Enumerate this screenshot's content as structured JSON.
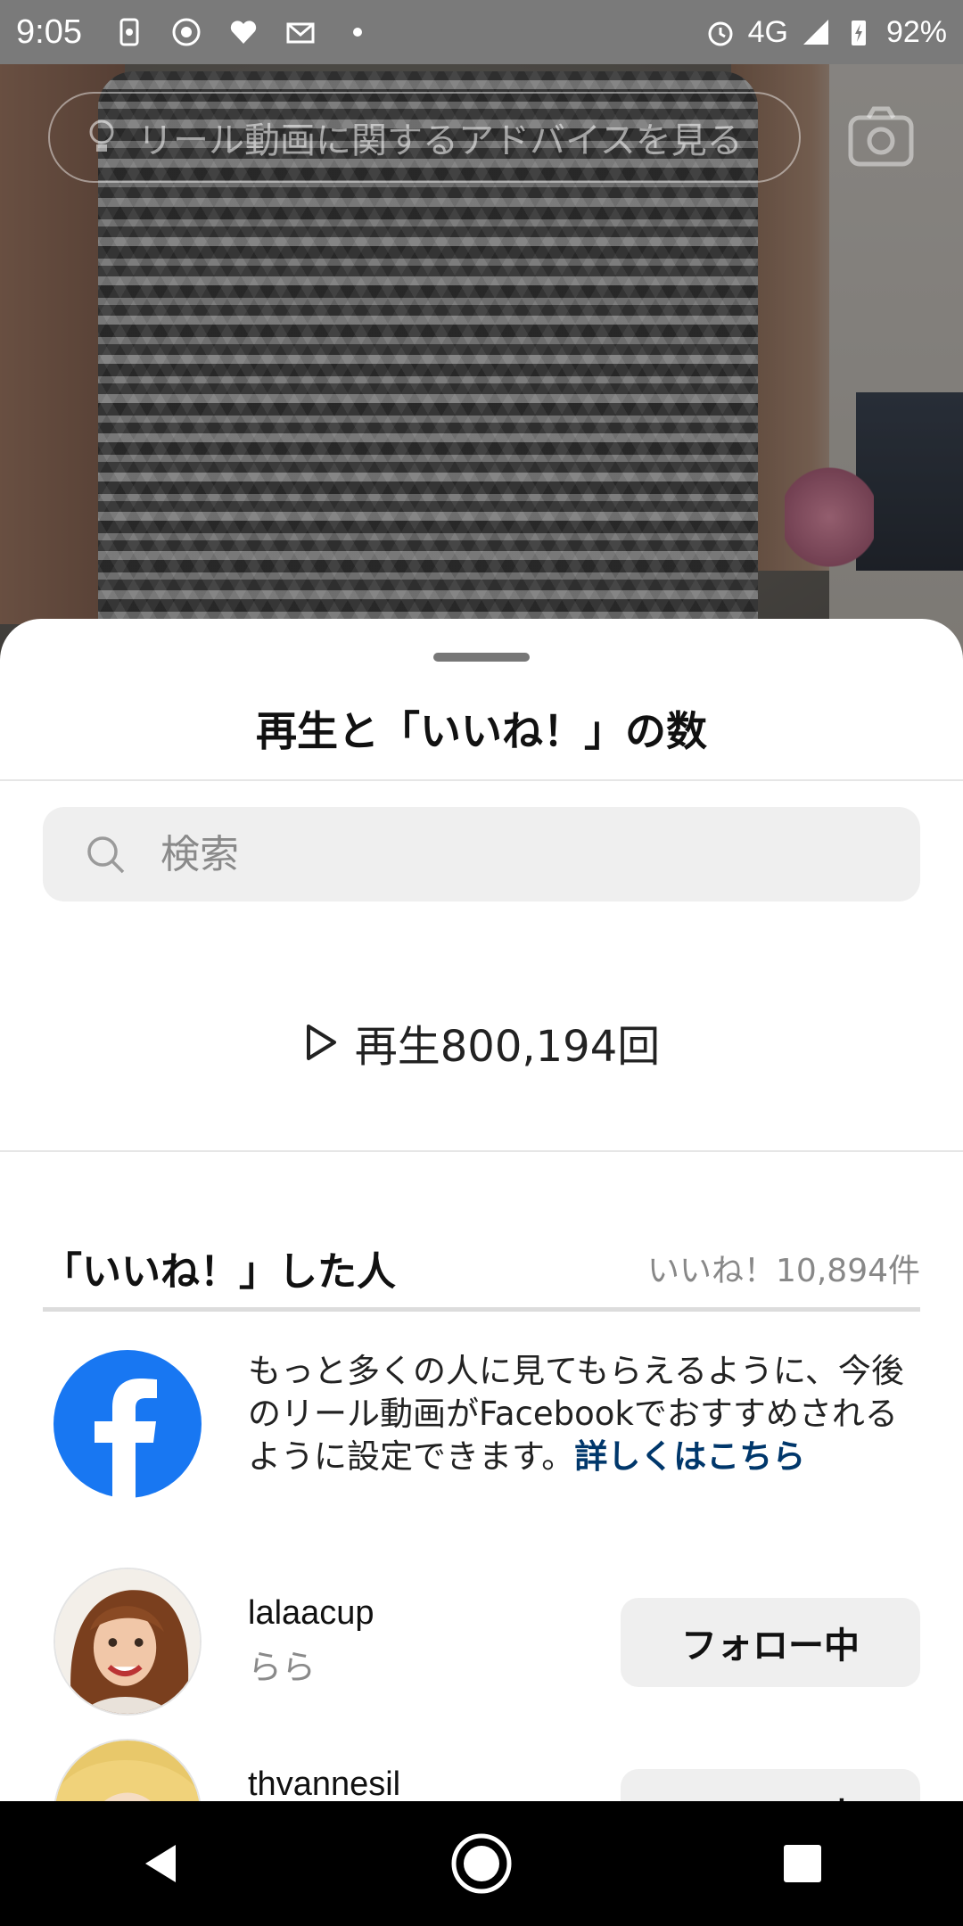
{
  "status_bar": {
    "time": "9:05",
    "network": "4G",
    "battery": "92%"
  },
  "overlay": {
    "tips_label": "リール動画に関するアドバイスを見る"
  },
  "sheet": {
    "title": "再生と「いいね！」の数",
    "search": {
      "placeholder": "検索",
      "value": ""
    },
    "plays_text": "再生800,194回",
    "likes_header": {
      "label": "「いいね！」した人",
      "count": "いいね！10,894件"
    },
    "facebook_promo": {
      "text": "もっと多くの人に見てもらえるように、今後のリール動画がFacebookでおすすめされるように設定できます。",
      "link": "詳しくはこちら"
    },
    "likers": [
      {
        "username": "lalaacup",
        "full_name": "らら",
        "button": "フォロー中"
      },
      {
        "username": "thvannesil",
        "full_name": "",
        "button": "フォロー中"
      }
    ]
  },
  "icons": {
    "tips": "lightbulb-icon",
    "camera": "camera-icon",
    "search": "search-icon",
    "play": "play-icon",
    "facebook": "facebook-logo-icon",
    "nav": [
      "back-icon",
      "home-icon",
      "recents-icon"
    ]
  },
  "colors": {
    "link": "#00376b",
    "facebook_blue": "#1877f2",
    "button_bg": "#efefef"
  }
}
